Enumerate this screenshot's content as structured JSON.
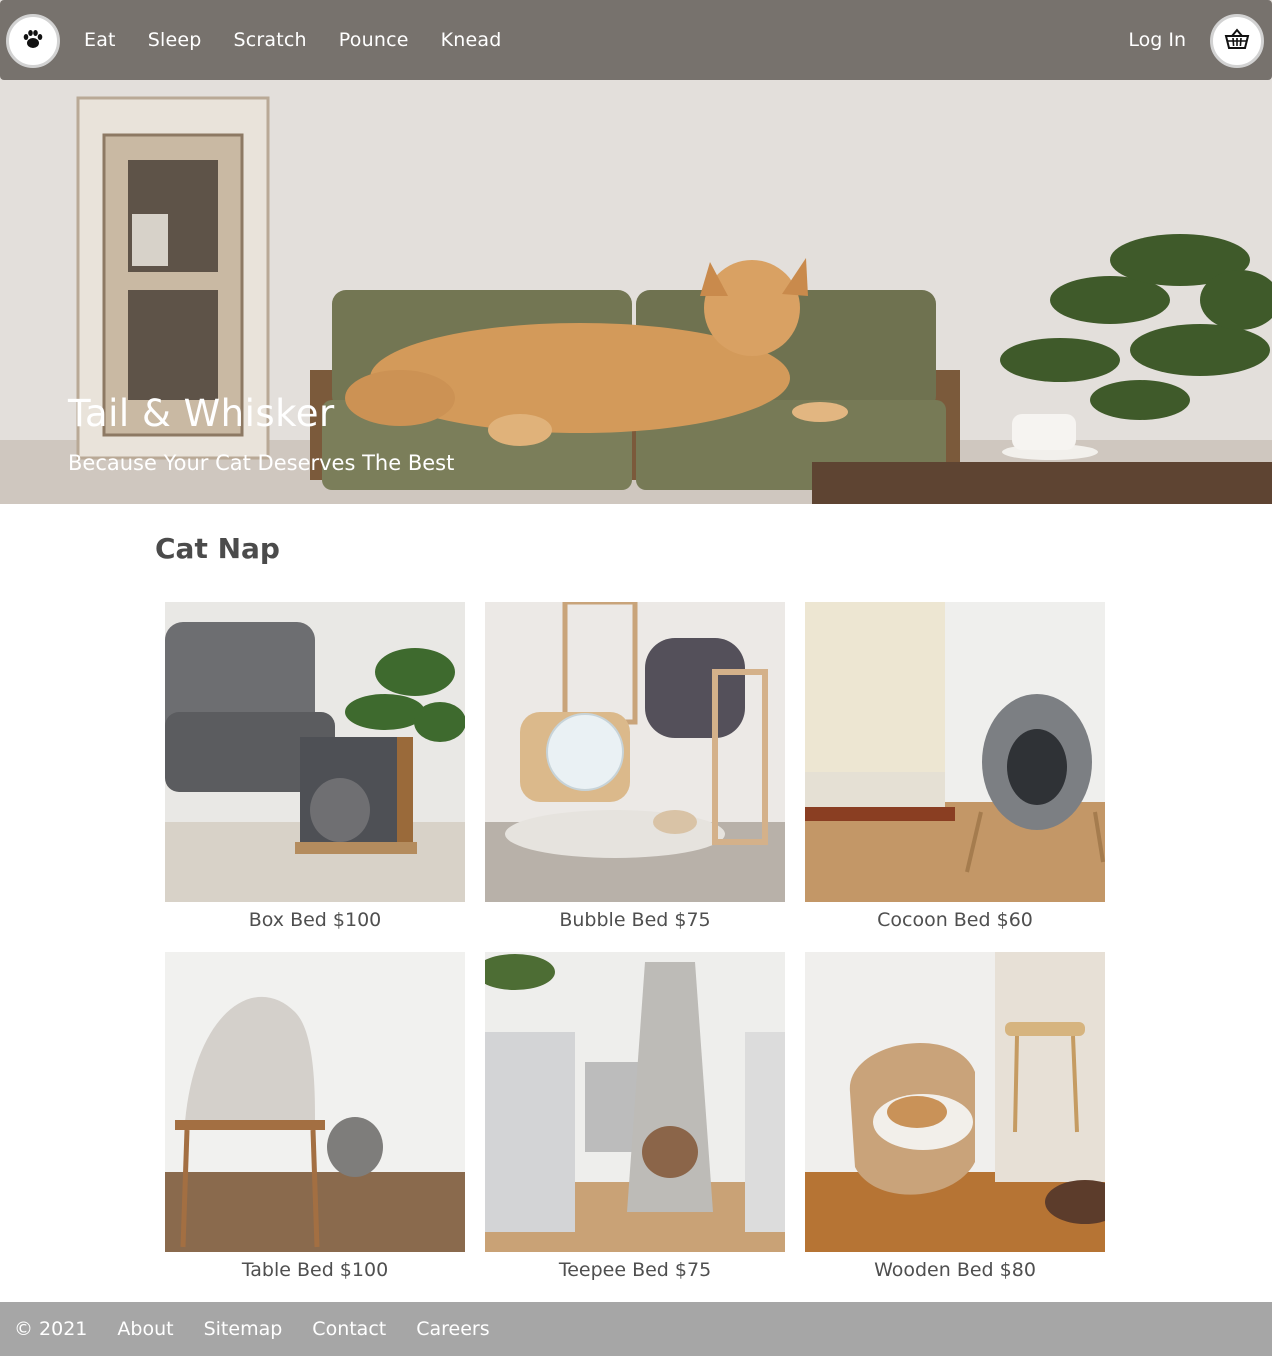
{
  "header": {
    "nav": [
      {
        "label": "Eat"
      },
      {
        "label": "Sleep"
      },
      {
        "label": "Scratch"
      },
      {
        "label": "Pounce"
      },
      {
        "label": "Knead"
      }
    ],
    "login_label": "Log In",
    "logo_icon": "paw-icon",
    "cart_icon": "basket-icon"
  },
  "hero": {
    "title": "Tail & Whisker",
    "subtitle": "Because Your Cat Deserves The Best"
  },
  "section": {
    "title": "Cat Nap"
  },
  "products": [
    {
      "caption": "Box Bed $100"
    },
    {
      "caption": "Bubble Bed $75"
    },
    {
      "caption": "Cocoon Bed $60"
    },
    {
      "caption": "Table Bed $100"
    },
    {
      "caption": "Teepee Bed $75"
    },
    {
      "caption": "Wooden Bed $80"
    }
  ],
  "footer": {
    "copyright": "© 2021",
    "links": [
      {
        "label": "About"
      },
      {
        "label": "Sitemap"
      },
      {
        "label": "Contact"
      },
      {
        "label": "Careers"
      }
    ]
  },
  "colors": {
    "header_bg": "#6e6864",
    "footer_bg": "#a6a6a6",
    "text": "#4f4f4f"
  }
}
